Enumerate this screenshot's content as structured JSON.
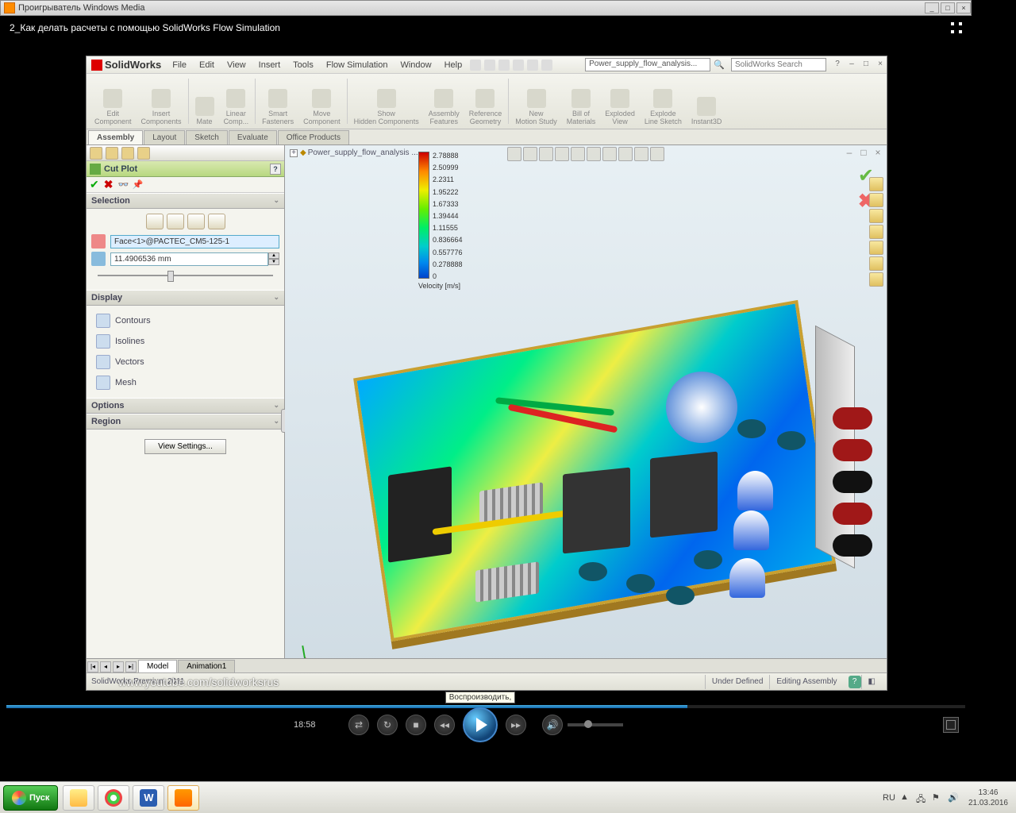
{
  "wmp": {
    "title": "Проигрыватель Windows Media",
    "video_title": "2_Как делать расчеты с помощью SolidWorks Flow Simulation",
    "time": "18:58",
    "tooltip": "Воспроизводить,"
  },
  "sw": {
    "logo": "SolidWorks",
    "menu": [
      "File",
      "Edit",
      "View",
      "Insert",
      "Tools",
      "Flow Simulation",
      "Window",
      "Help"
    ],
    "doc_name": "Power_supply_flow_analysis...",
    "search_placeholder": "SolidWorks Search",
    "ribbon": [
      {
        "l1": "Edit",
        "l2": "Component"
      },
      {
        "l1": "Insert",
        "l2": "Components"
      },
      {
        "l1": "Mate",
        "l2": ""
      },
      {
        "l1": "Linear",
        "l2": "Comp..."
      },
      {
        "l1": "Smart",
        "l2": "Fasteners"
      },
      {
        "l1": "Move",
        "l2": "Component"
      },
      {
        "l1": "Show",
        "l2": "Hidden Components"
      },
      {
        "l1": "Assembly",
        "l2": "Features"
      },
      {
        "l1": "Reference",
        "l2": "Geometry"
      },
      {
        "l1": "New",
        "l2": "Motion Study"
      },
      {
        "l1": "Bill of",
        "l2": "Materials"
      },
      {
        "l1": "Exploded",
        "l2": "View"
      },
      {
        "l1": "Explode",
        "l2": "Line Sketch"
      },
      {
        "l1": "Instant3D",
        "l2": ""
      }
    ],
    "tabs": [
      "Assembly",
      "Layout",
      "Sketch",
      "Evaluate",
      "Office Products"
    ],
    "active_tab": "Assembly",
    "pm": {
      "title": "Cut Plot",
      "selection_hdr": "Selection",
      "face_value": "Face<1>@PACTEC_CM5-125-1",
      "offset_value": "11.4906536 mm",
      "display_hdr": "Display",
      "display_items": [
        "Contours",
        "Isolines",
        "Vectors",
        "Mesh"
      ],
      "options_hdr": "Options",
      "region_hdr": "Region",
      "view_settings_btn": "View Settings..."
    },
    "gfx_tree": "Power_supply_flow_analysis ...",
    "legend_values": [
      "2.78888",
      "2.50999",
      "2.2311",
      "1.95222",
      "1.67333",
      "1.39444",
      "1.11555",
      "0.836664",
      "0.557776",
      "0.278888",
      "0"
    ],
    "legend_title": "Velocity [m/s]",
    "bottom_tabs": [
      "Model",
      "Animation1"
    ],
    "status_left": "SolidWorks Premium 2011",
    "status_right1": "Under Defined",
    "status_right2": "Editing Assembly",
    "watermark": "www.youtube.com/solidworksrus"
  },
  "taskbar": {
    "start": "Пуск",
    "lang": "RU",
    "time": "13:46",
    "date": "21.03.2016"
  },
  "chart_data": {
    "type": "colorbar",
    "title": "Velocity [m/s]",
    "range": [
      0,
      2.78888
    ],
    "ticks": [
      2.78888,
      2.50999,
      2.2311,
      1.95222,
      1.67333,
      1.39444,
      1.11555,
      0.836664,
      0.557776,
      0.278888,
      0
    ],
    "colormap": "rainbow (red=max, blue=min)"
  }
}
